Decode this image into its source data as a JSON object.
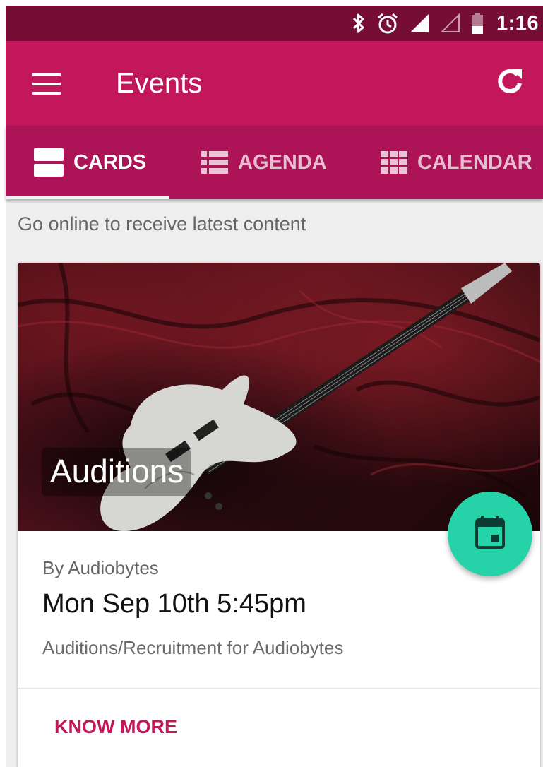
{
  "status_bar": {
    "time": "1:16",
    "icons": [
      "bluetooth-icon",
      "alarm-icon",
      "signal-full-icon",
      "signal-empty-icon",
      "battery-icon"
    ]
  },
  "app_bar": {
    "title": "Events",
    "menu_icon": "hamburger-menu-icon",
    "refresh_icon": "refresh-icon"
  },
  "tabs": [
    {
      "label": "CARDS",
      "icon": "cards-view-icon",
      "selected": true
    },
    {
      "label": "AGENDA",
      "icon": "list-view-icon",
      "selected": false
    },
    {
      "label": "CALENDAR",
      "icon": "grid-view-icon",
      "selected": false
    }
  ],
  "offline_message": "Go online to receive latest content",
  "event_card": {
    "image_title": "Auditions",
    "organizer": "By Audiobytes",
    "date_time": "Mon Sep 10th 5:45pm",
    "description": "Auditions/Recruitment for Audiobytes",
    "action_label": "KNOW MORE",
    "fab_icon": "calendar-event-icon"
  },
  "colors": {
    "status_bar": "#760d35",
    "primary": "#c2185b",
    "tab_bar": "#ad1457",
    "fab": "#26d3a8",
    "background": "#eeeeee"
  }
}
